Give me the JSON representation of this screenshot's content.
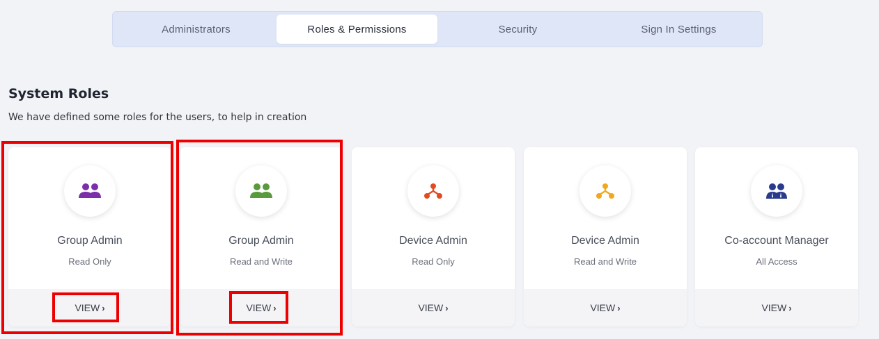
{
  "tabs": [
    {
      "label": "Administrators",
      "active": false
    },
    {
      "label": "Roles & Permissions",
      "active": true
    },
    {
      "label": "Security",
      "active": false
    },
    {
      "label": "Sign In Settings",
      "active": false
    }
  ],
  "section": {
    "title": "System Roles",
    "subtitle": "We have defined some roles for the users, to help in creation"
  },
  "cards": [
    {
      "name": "Group Admin",
      "access": "Read Only",
      "view_label": "VIEW",
      "icon": "group-icon",
      "icon_color": "#7b2fa8"
    },
    {
      "name": "Group Admin",
      "access": "Read and Write",
      "view_label": "VIEW",
      "icon": "group-icon",
      "icon_color": "#5a9a3c"
    },
    {
      "name": "Device Admin",
      "access": "Read Only",
      "view_label": "VIEW",
      "icon": "hierarchy-icon",
      "icon_color": "#e24b1f"
    },
    {
      "name": "Device Admin",
      "access": "Read and Write",
      "view_label": "VIEW",
      "icon": "hierarchy-icon",
      "icon_color": "#f0a820"
    },
    {
      "name": "Co-account Manager",
      "access": "All Access",
      "view_label": "VIEW",
      "icon": "managers-icon",
      "icon_color": "#2a3a8c"
    }
  ],
  "highlight_color": "#ee0000"
}
